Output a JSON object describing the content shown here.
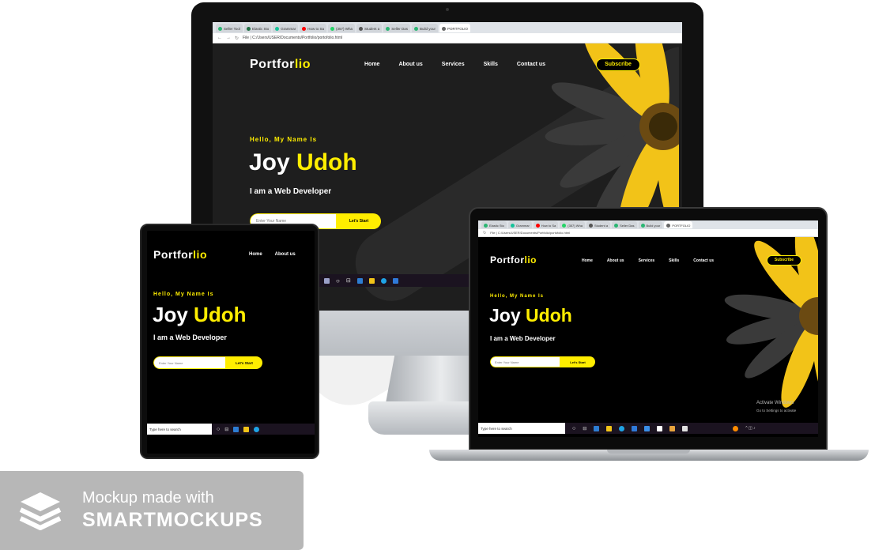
{
  "site": {
    "logo_main": "Portfor",
    "logo_highlight": "lio",
    "nav": [
      "Home",
      "About us",
      "Services",
      "Skills",
      "Contact us"
    ],
    "subscribe": "Subscribe",
    "hello": "Hello, My Name Is",
    "first_name": "Joy",
    "last_name": "Udoh",
    "role": "I am a Web Developer",
    "input_placeholder": "Enter Your Name",
    "cta": "Let's Start"
  },
  "browser": {
    "tabs": [
      "Seller Tool",
      "Elastic Sto",
      "Grammar",
      "How to Sa",
      "(357) Wha",
      "Student a",
      "Seller Das",
      "Build your",
      "PORTFOLIO"
    ],
    "address": "File | C:/Users/USER/Documents/Portfolio/portofolio.html"
  },
  "taskbar": {
    "search": "Type here to search"
  },
  "laptop": {
    "activate_1": "Activate Windows",
    "activate_2": "Go to Settings to activate"
  },
  "watermark": {
    "line1": "Mockup made with",
    "line2": "SMARTMOCKUPS"
  },
  "colors": {
    "accent": "#ffee00",
    "background": "#1e1e1e",
    "text": "#ffffff"
  }
}
